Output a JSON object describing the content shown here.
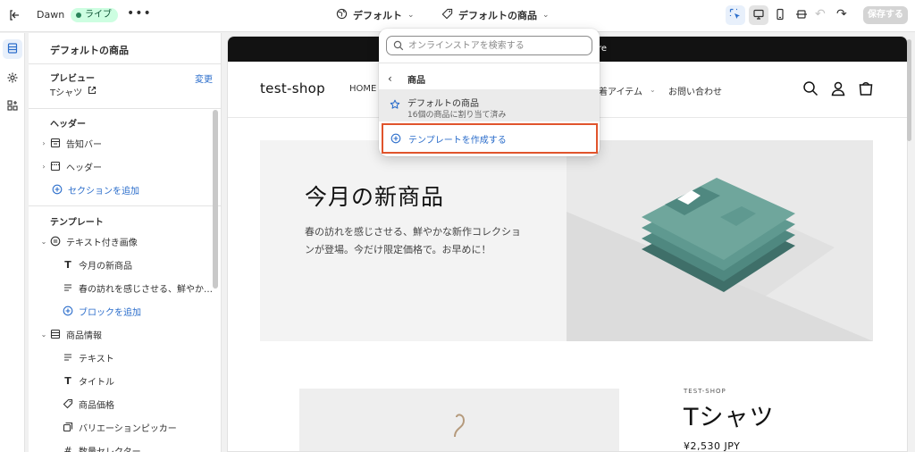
{
  "topbar": {
    "theme_name": "Dawn",
    "live_badge": "ライブ",
    "more_label": "•••",
    "template_selector": "デフォルト",
    "page_selector": "デフォルトの商品",
    "save_label": "保存する"
  },
  "sidebar": {
    "title": "デフォルトの商品",
    "preview_label": "プレビュー",
    "preview_change": "変更",
    "preview_product": "Tシャツ",
    "header_section_label": "ヘッダー",
    "header_items": [
      {
        "label": "告知バー",
        "icon": "announcement-bar-icon"
      },
      {
        "label": "ヘッダー",
        "icon": "header-layout-icon"
      }
    ],
    "add_section": "セクションを追加",
    "template_section_label": "テンプレート",
    "template_items": [
      {
        "label": "テキスト付き画像",
        "icon": "image-with-text-icon"
      },
      {
        "label": "今月の新商品",
        "icon": "text-type-icon"
      },
      {
        "label": "春の訪れを感じさせる、鮮やか…",
        "icon": "paragraph-icon"
      },
      {
        "label": "ブロックを追加",
        "icon": "plus-circle-icon"
      },
      {
        "label": "商品情報",
        "icon": "product-info-icon"
      },
      {
        "label": "テキスト",
        "icon": "paragraph-icon"
      },
      {
        "label": "タイトル",
        "icon": "text-type-icon"
      },
      {
        "label": "商品価格",
        "icon": "price-tag-icon"
      },
      {
        "label": "バリエーションピッカー",
        "icon": "variant-picker-icon"
      },
      {
        "label": "数量セレクター",
        "icon": "hash-icon"
      }
    ]
  },
  "popover": {
    "search_placeholder": "オンラインストアを検索する",
    "back_label": "商品",
    "current_title": "デフォルトの商品",
    "current_subtitle": "16個の商品に割り当て済み",
    "create_label": "テンプレートを作成する"
  },
  "preview": {
    "announcement": "re",
    "shop_name": "test-shop",
    "nav_items": [
      "HOME",
      "着アイテム",
      "お問い合わせ"
    ],
    "hero_title": "今月の新商品",
    "hero_text": "春の訪れを感じさせる、鮮やかな新作コレクションが登場。今だけ限定価格で。お早めに！",
    "product_vendor": "TEST-SHOP",
    "product_title": "Tシャツ",
    "product_price": "¥2,530 JPY"
  },
  "colors": {
    "accent_blue": "#2c6ecb",
    "highlight_red": "#e0542c",
    "live_green": "#29845a",
    "shirt_teal": "#6fa69c"
  }
}
